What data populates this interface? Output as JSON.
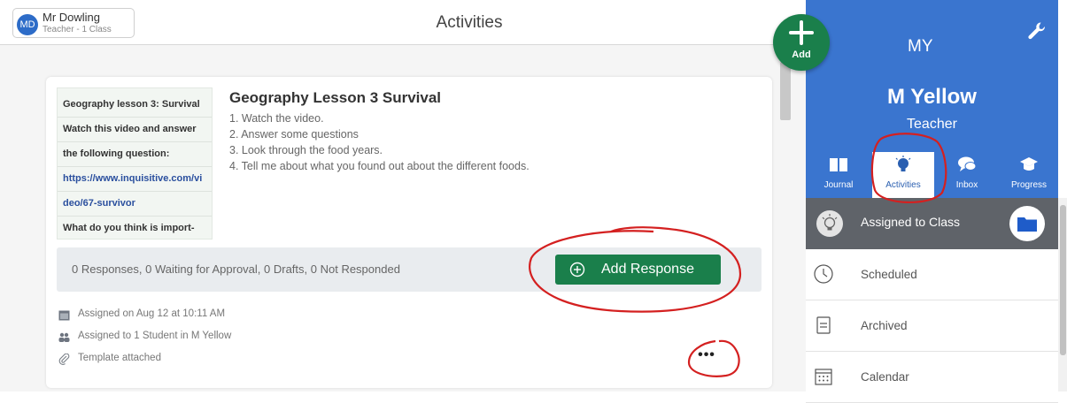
{
  "header": {
    "user_initials": "MD",
    "user_name": "Mr Dowling",
    "user_role": "Teacher - 1 Class",
    "page_title": "Activities"
  },
  "activity": {
    "thumbnail_lines": [
      "Geography lesson 3: Survival",
      "Watch this video and answer",
      "the following question:",
      "https://www.inquisitive.com/vi",
      "deo/67-survivor",
      "What do you think is import-"
    ],
    "title": "Geography Lesson 3 Survival",
    "steps": [
      "1. Watch the video.",
      "2. Answer some questions",
      "3. Look through the food years.",
      "4. Tell me about what you found out about the different foods."
    ],
    "responses_summary": "0 Responses, 0 Waiting for Approval, 0 Drafts, 0 Not Responded",
    "add_response_label": "Add Response",
    "meta": {
      "assigned_on": "Assigned on Aug 12 at 10:11 AM",
      "assigned_to": "Assigned to 1 Student in M Yellow",
      "template": "Template attached"
    },
    "more_label": "•••"
  },
  "fab": {
    "label": "Add"
  },
  "sidebar": {
    "initials": "MY",
    "class_name": "M Yellow",
    "role": "Teacher",
    "tabs": [
      {
        "label": "Journal",
        "icon": "book-icon"
      },
      {
        "label": "Activities",
        "icon": "lightbulb-icon"
      },
      {
        "label": "Inbox",
        "icon": "chat-icon"
      },
      {
        "label": "Progress",
        "icon": "graduation-cap-icon"
      }
    ],
    "assigned_label": "Assigned to Class",
    "items": [
      {
        "label": "Scheduled",
        "icon": "clock-icon"
      },
      {
        "label": "Archived",
        "icon": "archive-icon"
      },
      {
        "label": "Calendar",
        "icon": "calendar-icon"
      }
    ]
  },
  "colors": {
    "brand_blue": "#3a75cf",
    "action_green": "#1a7f4b",
    "annotation_red": "#d42020"
  }
}
